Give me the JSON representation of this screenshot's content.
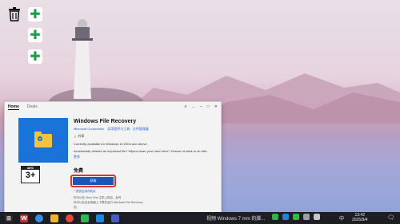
{
  "window": {
    "tabs": [
      "Home",
      "Deals"
    ],
    "more_label": "...",
    "search_icon": "search-icon",
    "window_controls": [
      "–",
      "□",
      "✕"
    ]
  },
  "app": {
    "title": "Windows File Recovery",
    "publisher": "Microsoft Corporation",
    "category": "实用程序与工具 · 文件管理器",
    "share": "共享",
    "desc1": "Currently available for Windows 10 2004 and above.",
    "desc2": "Accidentally deleted an important file? Wiped clean your hard drive? Unsure of what to do with",
    "more": "更多",
    "rating_top": "IARC",
    "rating_num": "3+",
    "price": "免费",
    "get_button": "获取",
    "offers": "+ 提供应用内购买",
    "note1": "你可以在 Xbox One 主机上购买。此时",
    "note2": "你可以在此台电脑上下载并运行 Windows File Recovery",
    "note3": "的。"
  },
  "taskbar": {
    "title_text": "视频 Windows 7 mm 的脚...",
    "language": "中",
    "time": "13:42",
    "date": "2025/9/4"
  },
  "colors": {
    "accent": "#1a56b8",
    "highlight": "#e0302a",
    "plus_green": "#1f9c4a"
  }
}
